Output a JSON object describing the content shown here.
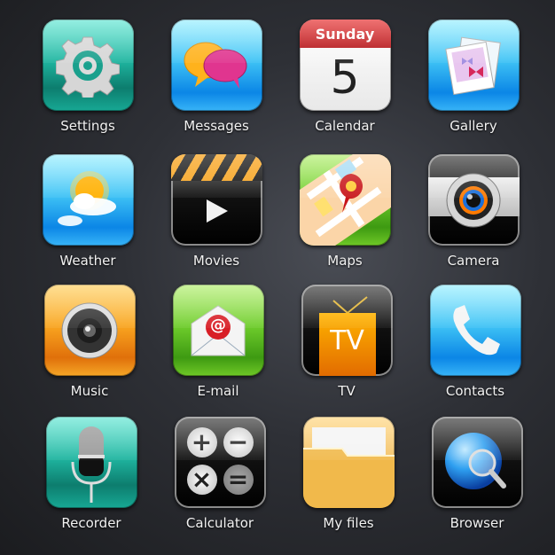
{
  "apps": [
    {
      "label": "Settings",
      "icon": "gear-icon"
    },
    {
      "label": "Messages",
      "icon": "chat-bubbles-icon"
    },
    {
      "label": "Calendar",
      "icon": "calendar-icon",
      "day_name": "Sunday",
      "day_number": "5"
    },
    {
      "label": "Gallery",
      "icon": "photos-icon"
    },
    {
      "label": "Weather",
      "icon": "sun-cloud-icon"
    },
    {
      "label": "Movies",
      "icon": "clapperboard-icon"
    },
    {
      "label": "Maps",
      "icon": "map-pin-icon"
    },
    {
      "label": "Camera",
      "icon": "camera-lens-icon"
    },
    {
      "label": "Music",
      "icon": "speaker-icon"
    },
    {
      "label": "E-mail",
      "icon": "envelope-icon",
      "glyph": "@"
    },
    {
      "label": "TV",
      "icon": "tv-icon",
      "glyph": "TV"
    },
    {
      "label": "Contacts",
      "icon": "phone-icon"
    },
    {
      "label": "Recorder",
      "icon": "microphone-icon"
    },
    {
      "label": "Calculator",
      "icon": "calculator-icon",
      "keys": [
        "+",
        "−",
        "×",
        "="
      ]
    },
    {
      "label": "My files",
      "icon": "folder-icon"
    },
    {
      "label": "Browser",
      "icon": "globe-search-icon"
    }
  ],
  "colors": {
    "teal": "#1fb5a0",
    "blue": "#3fc3f5",
    "orange": "#f9a520",
    "green": "#6fcd2c",
    "calendar_red": "#c8161a",
    "background": "#2e3036"
  }
}
